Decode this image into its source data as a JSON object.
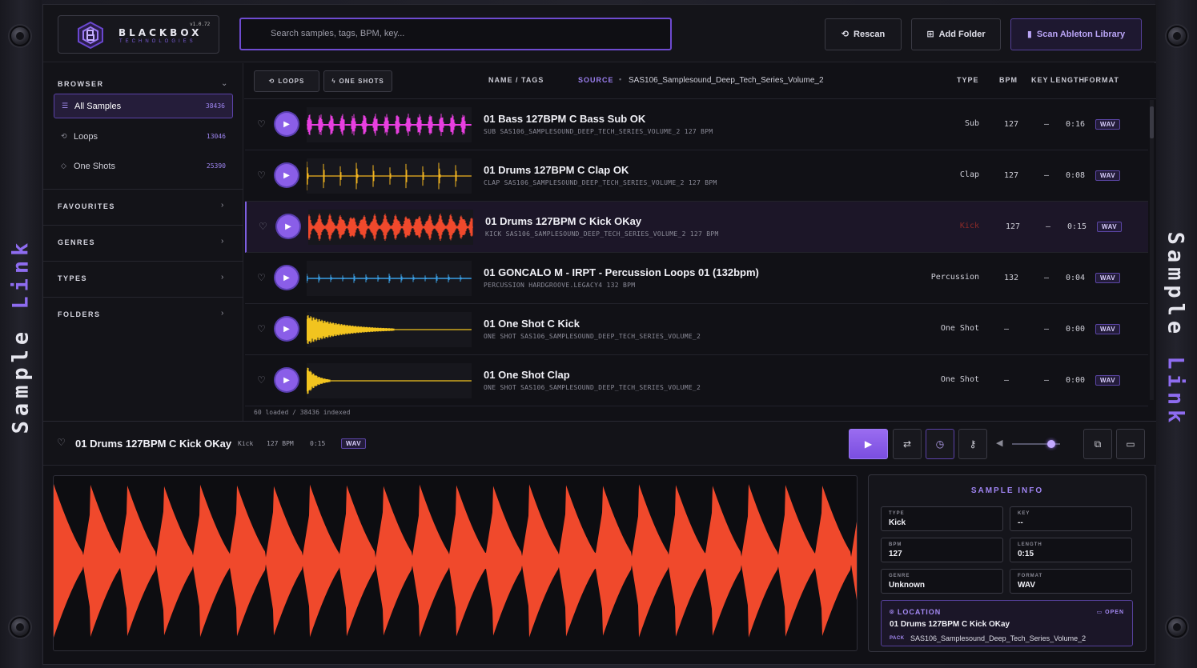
{
  "side_label": {
    "left_main": "Sample",
    "left_accent": "Link",
    "right_main": "Sample",
    "right_accent": "Link"
  },
  "logo": {
    "name": "BLACKBOX",
    "sub": "TECHNOLOGIES",
    "version": "v1.0.72"
  },
  "search": {
    "placeholder": "Search samples, tags, BPM, key..."
  },
  "toolbar": {
    "rescan": "Rescan",
    "add_folder": "Add Folder",
    "scan_ableton": "Scan Ableton Library"
  },
  "sidebar": {
    "browser": "BROWSER",
    "items": [
      {
        "label": "All Samples",
        "count": "38436",
        "icon": "list-icon"
      },
      {
        "label": "Loops",
        "count": "13046",
        "icon": "loop-icon"
      },
      {
        "label": "One Shots",
        "count": "25390",
        "icon": "tag-icon"
      }
    ],
    "sections": [
      "FAVOURITES",
      "GENRES",
      "TYPES",
      "FOLDERS"
    ]
  },
  "filters": {
    "loops": "LOOPS",
    "one_shots": "ONE SHOTS"
  },
  "columns": {
    "name": "NAME / TAGS",
    "source": "SOURCE",
    "source_value": "SAS106_Samplesound_Deep_Tech_Series_Volume_2",
    "type": "TYPE",
    "bpm": "BPM",
    "key": "KEY",
    "length": "LENGTH",
    "format": "FORMAT"
  },
  "rows": [
    {
      "title": "01 Bass 127BPM C Bass Sub OK",
      "sub": "SUB  SAS106_SAMPLESOUND_DEEP_TECH_SERIES_VOLUME_2  127 BPM",
      "type": "Sub",
      "bpm": "127",
      "key": "–",
      "length": "0:16",
      "format": "WAV",
      "color": "#e83fe0"
    },
    {
      "title": "01 Drums 127BPM C Clap OK",
      "sub": "CLAP  SAS106_SAMPLESOUND_DEEP_TECH_SERIES_VOLUME_2  127 BPM",
      "type": "Clap",
      "bpm": "127",
      "key": "–",
      "length": "0:08",
      "format": "WAV",
      "color": "#f2b41f"
    },
    {
      "title": "01 Drums 127BPM C Kick OKay",
      "sub": "KICK  SAS106_SAMPLESOUND_DEEP_TECH_SERIES_VOLUME_2  127 BPM",
      "type": "Kick",
      "bpm": "127",
      "key": "–",
      "length": "0:15",
      "format": "WAV",
      "color": "#f0492c"
    },
    {
      "title": "01 GONCALO M - IRPT - Percussion Loops 01 (132bpm)",
      "sub": "PERCUSSION  HARDGROOVE.LEGACY4  132 BPM",
      "type": "Percussion",
      "bpm": "132",
      "key": "–",
      "length": "0:04",
      "format": "WAV",
      "color": "#3aa0e8"
    },
    {
      "title": "01 One Shot C Kick",
      "sub": "ONE SHOT  SAS106_SAMPLESOUND_DEEP_TECH_SERIES_VOLUME_2",
      "type": "One Shot",
      "bpm": "–",
      "key": "–",
      "length": "0:00",
      "format": "WAV",
      "color": "#f2c41f"
    },
    {
      "title": "01 One Shot Clap",
      "sub": "ONE SHOT  SAS106_SAMPLESOUND_DEEP_TECH_SERIES_VOLUME_2",
      "type": "One Shot",
      "bpm": "–",
      "key": "–",
      "length": "0:00",
      "format": "WAV",
      "color": "#f2c41f"
    }
  ],
  "status": "60 loaded / 38436 indexed",
  "player": {
    "title": "01 Drums 127BPM C Kick OKay",
    "type": "Kick",
    "bpm": "127 BPM",
    "length": "0:15",
    "format": "WAV",
    "volume": 0.82
  },
  "info": {
    "title": "SAMPLE INFO",
    "fields": [
      {
        "k": "TYPE",
        "v": "Kick"
      },
      {
        "k": "KEY",
        "v": "--"
      },
      {
        "k": "BPM",
        "v": "127"
      },
      {
        "k": "LENGTH",
        "v": "0:15"
      },
      {
        "k": "GENRE",
        "v": "Unknown"
      },
      {
        "k": "FORMAT",
        "v": "WAV"
      }
    ],
    "location_label": "LOCATION",
    "open": "OPEN",
    "file": "01 Drums 127BPM C Kick OKay",
    "pack_label": "PACK",
    "pack": "SAS106_Samplesound_Deep_Tech_Series_Volume_2"
  },
  "colors": {
    "accent": "#8a5ee8",
    "kick_wave": "#f0492c"
  }
}
